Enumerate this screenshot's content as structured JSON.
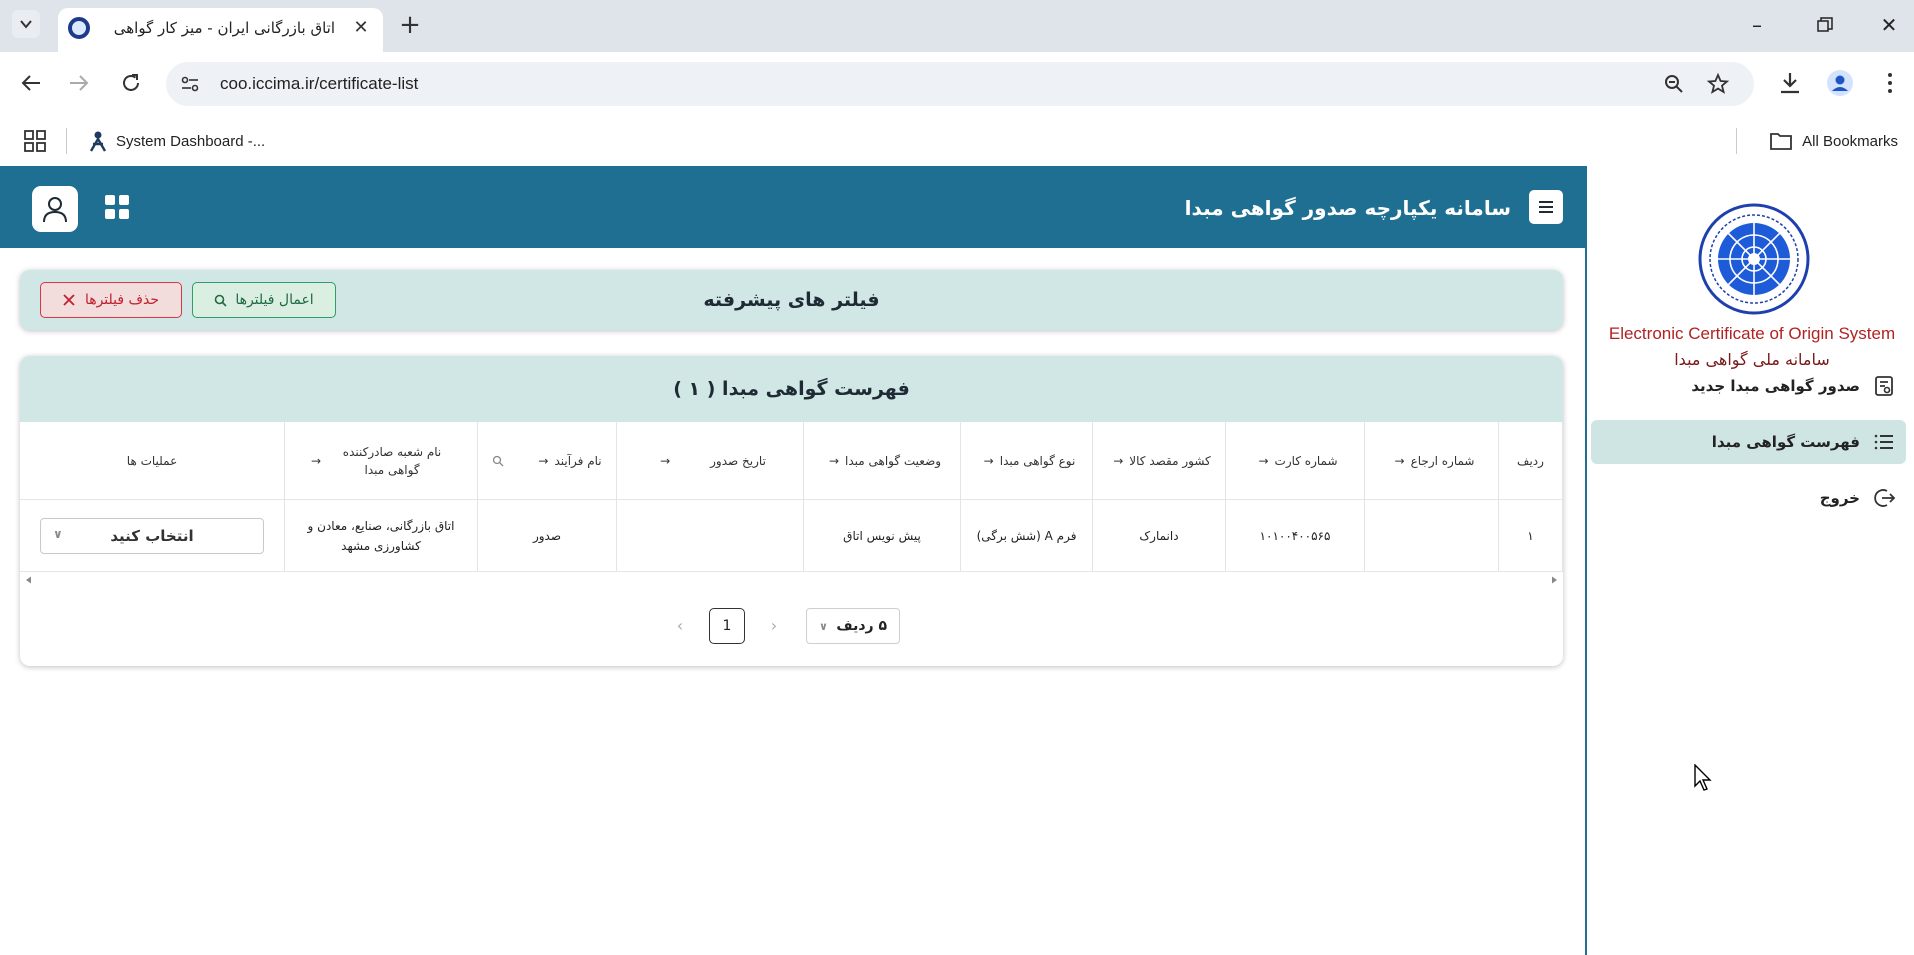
{
  "browser": {
    "tab_title": "اتاق بازرگانی ایران - میز کار گواهی",
    "url": "coo.iccima.ir/certificate-list",
    "bookmarks": [
      {
        "label": "System Dashboard -..."
      }
    ],
    "all_bookmarks_label": "All Bookmarks"
  },
  "app": {
    "title": "سامانه یکپارچه صدور گواهی مبدا"
  },
  "sidebar": {
    "logo_en": "Electronic Certificate of Origin System",
    "logo_fa": "سامانه ملی گواهی مبدا",
    "items": [
      {
        "label": "صدور گواهی مبدا جدید",
        "icon": "certificate-icon",
        "active": false
      },
      {
        "label": "فهرست گواهی مبدا",
        "icon": "list-icon",
        "active": true
      },
      {
        "label": "خروج",
        "icon": "logout-icon",
        "active": false
      }
    ]
  },
  "filters": {
    "title": "فیلتر های پیشرفته",
    "apply_label": "اعمال فیلترها",
    "clear_label": "حذف فیلترها"
  },
  "list": {
    "title": "فهرست گواهی مبدا ( ۱ )",
    "columns": [
      {
        "label": "ردیف",
        "sortable": false
      },
      {
        "label": "شماره ارجاع",
        "sortable": true
      },
      {
        "label": "شماره کارت",
        "sortable": true
      },
      {
        "label": "کشور مقصد کالا",
        "sortable": true
      },
      {
        "label": "نوع گواهی مبدا",
        "sortable": true
      },
      {
        "label": "وضعیت گواهی مبدا",
        "sortable": true
      },
      {
        "label": "تاریخ صدور",
        "sortable": true
      },
      {
        "label": "نام فرآیند",
        "sortable": true,
        "searchable": true
      },
      {
        "label": "نام شعبه صادرکننده گواهی مبدا",
        "sortable": true
      },
      {
        "label": "عملیات ها",
        "sortable": false
      }
    ],
    "rows": [
      {
        "index": "۱",
        "reference_no": "",
        "card_no": "۱۰۱۰۰۴۰۰۵۶۵",
        "destination": "دانمارک",
        "type": "فرم A (شش برگی)",
        "status": "پیش نویس اتاق",
        "issue_date": "",
        "process": "صدور",
        "branch": "اتاق بازرگانی، صنایع، معادن و کشاورزی مشهد",
        "action_placeholder": "انتخاب کنید"
      }
    ],
    "pagination": {
      "current_page": "1",
      "page_size_label": "۵ ردیف"
    }
  },
  "colors": {
    "header_bg": "#1f6f92",
    "panel_bg": "#d1e7e6",
    "danger": "#dc3545",
    "success": "#2f9e66"
  }
}
